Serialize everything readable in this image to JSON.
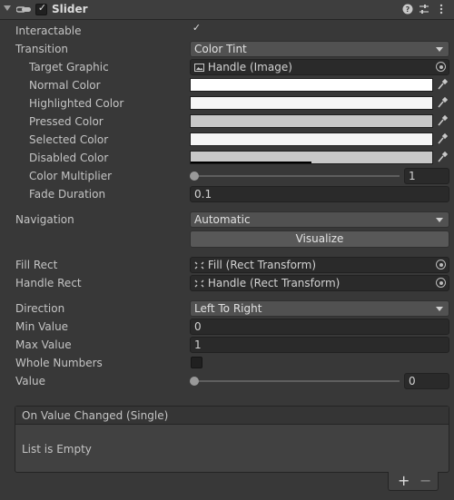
{
  "header": {
    "title": "Slider",
    "enabled": true,
    "icons": [
      "foldout-arrow-icon",
      "script-icon",
      "help-icon",
      "presets-icon",
      "menu-icon"
    ]
  },
  "rows": {
    "interactable": {
      "label": "Interactable",
      "checked": true
    },
    "transition": {
      "label": "Transition",
      "value": "Color Tint"
    },
    "target_graphic": {
      "label": "Target Graphic",
      "value": "Handle (Image)"
    },
    "normal_color": {
      "label": "Normal Color",
      "color": "#ffffff"
    },
    "highlighted_color": {
      "label": "Highlighted Color",
      "color": "#f5f5f5"
    },
    "pressed_color": {
      "label": "Pressed Color",
      "color": "#c8c8c8"
    },
    "selected_color": {
      "label": "Selected Color",
      "color": "#f5f5f5"
    },
    "disabled_color": {
      "label": "Disabled Color",
      "color": "#c8c8c8",
      "alpha": 0.5
    },
    "color_multiplier": {
      "label": "Color Multiplier",
      "value": "1",
      "slider_fraction": 0.0
    },
    "fade_duration": {
      "label": "Fade Duration",
      "value": "0.1"
    },
    "navigation": {
      "label": "Navigation",
      "value": "Automatic"
    },
    "visualize": {
      "label": "Visualize"
    },
    "fill_rect": {
      "label": "Fill Rect",
      "value": "Fill (Rect Transform)"
    },
    "handle_rect": {
      "label": "Handle Rect",
      "value": "Handle (Rect Transform)"
    },
    "direction": {
      "label": "Direction",
      "value": "Left To Right"
    },
    "min_value": {
      "label": "Min Value",
      "value": "0"
    },
    "max_value": {
      "label": "Max Value",
      "value": "1"
    },
    "whole_numbers": {
      "label": "Whole Numbers",
      "checked": false
    },
    "value": {
      "label": "Value",
      "value": "0",
      "slider_fraction": 0.0
    }
  },
  "event": {
    "title": "On Value Changed (Single)",
    "empty_text": "List is Empty",
    "add_label": "+",
    "remove_label": "−"
  }
}
